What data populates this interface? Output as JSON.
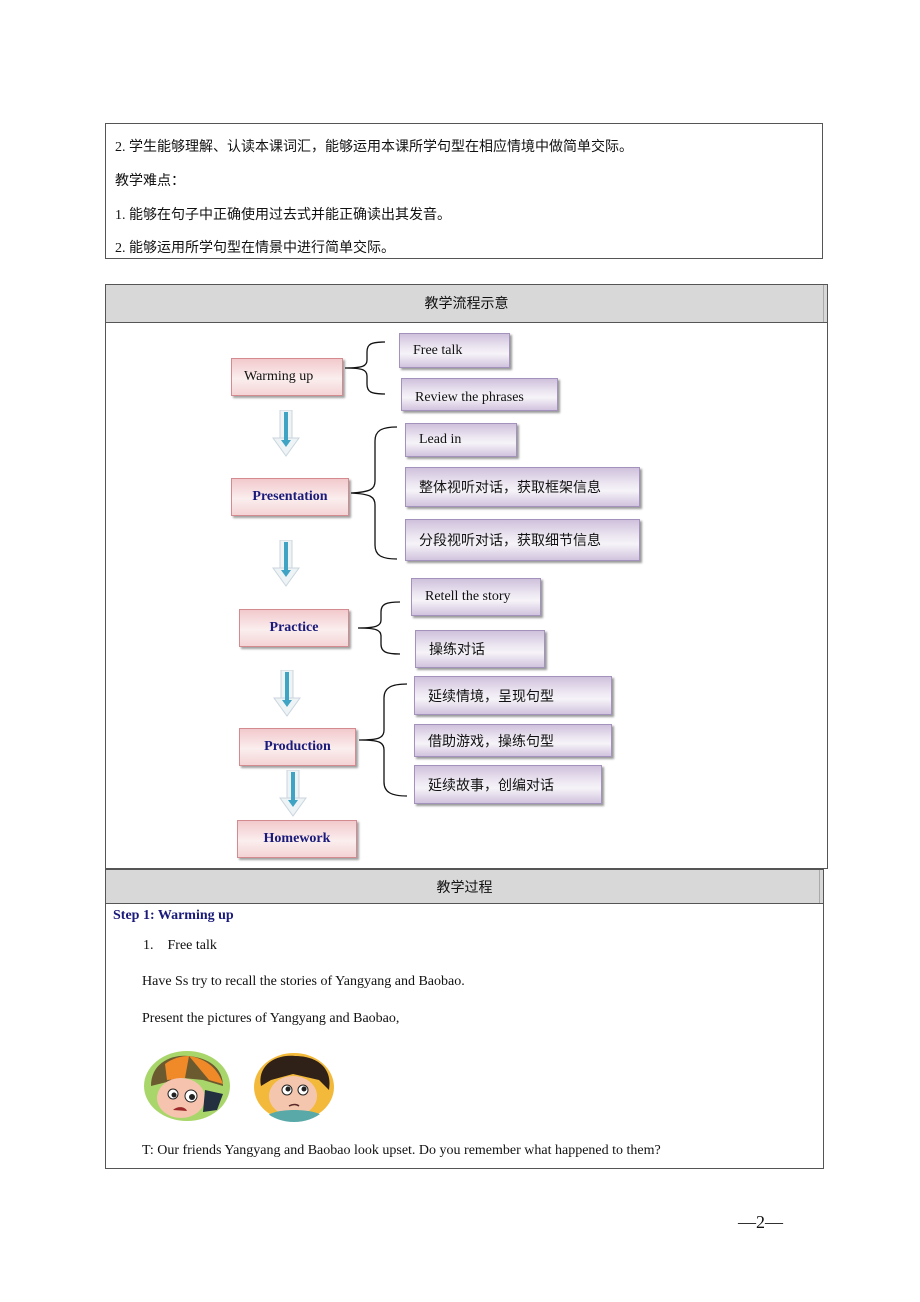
{
  "objectives": {
    "lines": [
      "2.  学生能够理解、认读本课词汇，能够运用本课所学句型在相应情境中做简单交际。",
      "教学难点：",
      "1.  能够在句子中正确使用过去式并能正确读出其发音。",
      "2.  能够运用所学句型在情景中进行简单交际。"
    ]
  },
  "flow": {
    "header": "教学流程示意",
    "stages": [
      {
        "label": "Warming up",
        "substeps": [
          "Free talk",
          "Review the phrases"
        ]
      },
      {
        "label": "Presentation",
        "substeps": [
          "Lead in",
          "整体视听对话，获取框架信息",
          "分段视听对话，获取细节信息"
        ]
      },
      {
        "label": "Practice",
        "substeps": [
          "Retell the story",
          "操练对话"
        ]
      },
      {
        "label": "Production",
        "substeps": [
          "延续情境，呈现句型",
          "借助游戏，操练句型",
          "延续故事，创编对话"
        ]
      },
      {
        "label": "Homework",
        "substeps": []
      }
    ],
    "colors": {
      "stage_text": "#1a1a7a",
      "arrow": "#3fa3c4",
      "stage_box": "#f2c9cc",
      "substep_box": "#ddd2e8"
    }
  },
  "process": {
    "header": "教学过程",
    "step_title": "Step 1: Warming up",
    "item": "1.    Free talk",
    "paragraphs": [
      "Have Ss try to recall the stories of Yangyang and Baobao.",
      "Present the pictures of Yangyang and Baobao,",
      "T: Our friends Yangyang and Baobao look upset. Do you remember what happened to them?"
    ],
    "images": [
      {
        "name": "Yangyang",
        "icon": "boy-with-cap-portrait"
      },
      {
        "name": "Baobao",
        "icon": "boy-portrait"
      }
    ]
  },
  "footer": {
    "page_number": "—2—"
  }
}
